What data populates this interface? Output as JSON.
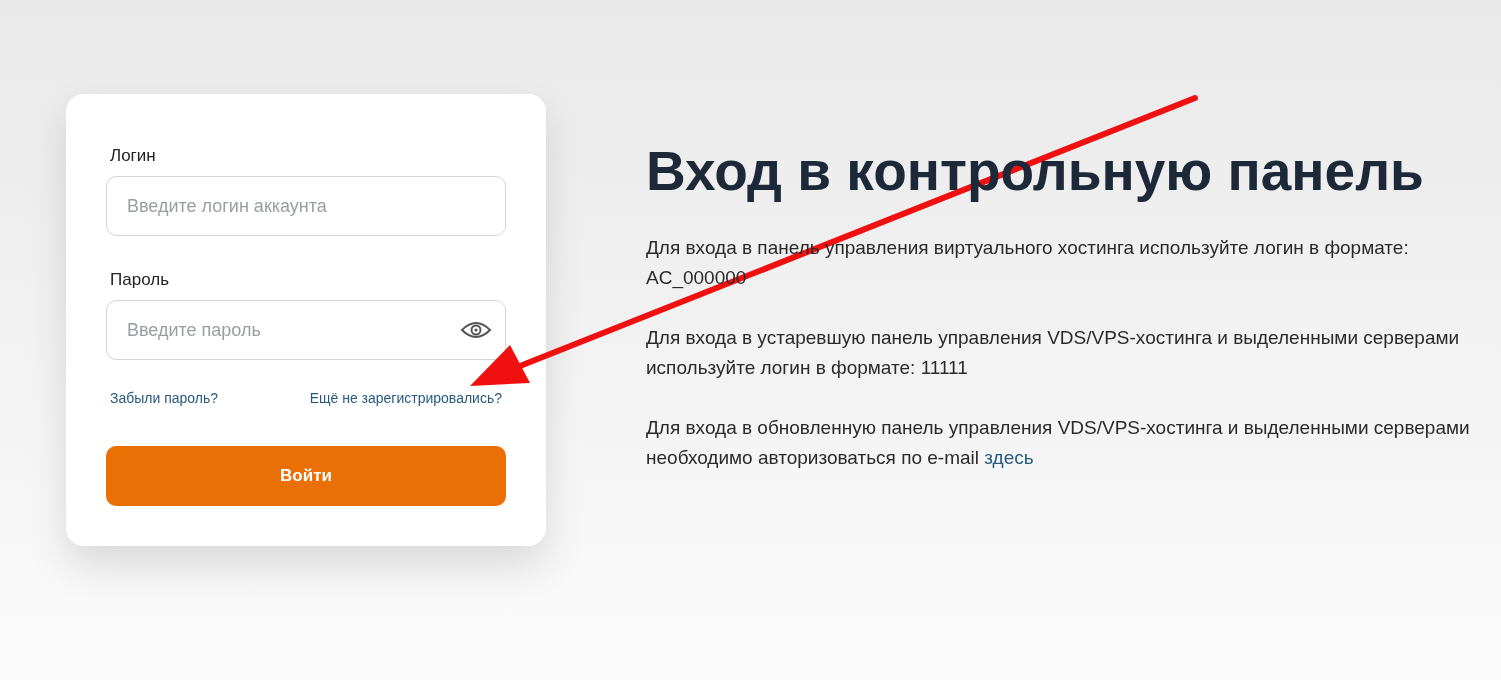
{
  "login_form": {
    "fields": [
      {
        "kind": "text",
        "label": "Логин",
        "placeholder": "Введите логин аккаунта"
      },
      {
        "kind": "password",
        "label": "Пароль",
        "placeholder": "Введите пароль"
      }
    ],
    "links": [
      "Забыли пароль?",
      "Ещё не зарегистрировались?"
    ],
    "submit": "Войти"
  },
  "info": {
    "title": "Вход в контрольную панель",
    "paragraphs": [
      {
        "text": "Для входа в панель управления виртуального хостинга используйте логин в формате: AC_000000"
      },
      {
        "text": "Для входа в устаревшую панель управления VDS/VPS-хостинга и выделенными серверами используйте логин в формате: 11111"
      },
      {
        "text": "Для входа в обновленную панель управления VDS/VPS-хостинга и выделенными серверами необходимо авторизоваться по e-mail",
        "link": "здесь"
      }
    ]
  },
  "annotation": {
    "kind": "arrow"
  }
}
